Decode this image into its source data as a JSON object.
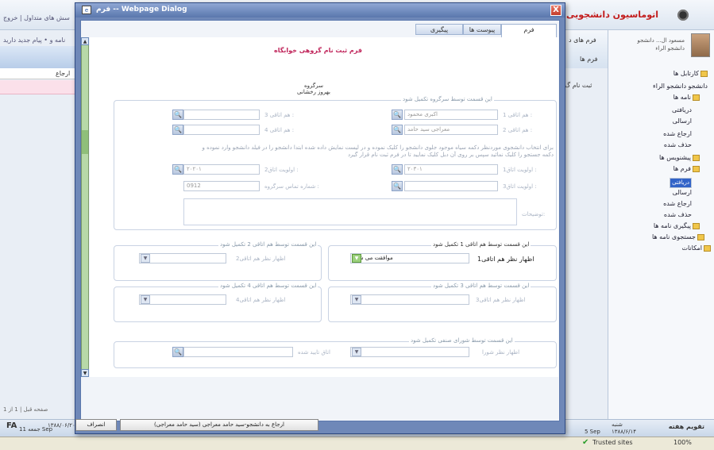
{
  "background": {
    "logo_text": "اتوماسیون دانشجویی",
    "top_links": "سش های متداول | خروج",
    "sub_links": "نامه و • پیام جدید دارید",
    "col_label": "ارجاع",
    "mid_header_l1": "فرم های د",
    "mid_header_l2": "فرم ها",
    "mid_row": "ثبت نام گ",
    "user_name": "مسعود ال... دانشجو دانشجو الراء",
    "tree": [
      {
        "label": "کارتابل ها",
        "selected": false
      },
      {
        "label": "دانشجو دانشجو الراء",
        "selected": false
      },
      {
        "label": "نامه ها",
        "selected": false
      },
      {
        "label": "دریافتی",
        "selected": false
      },
      {
        "label": "ارسالی",
        "selected": false
      },
      {
        "label": "ارجاع شده",
        "selected": false
      },
      {
        "label": "حذف شده",
        "selected": false
      },
      {
        "label": "پیشنویس ها",
        "selected": false
      },
      {
        "label": "فرم ها",
        "selected": false
      },
      {
        "label": "دریافتی",
        "selected": true
      },
      {
        "label": "ارسالی",
        "selected": false
      },
      {
        "label": "ارجاع شده",
        "selected": false
      },
      {
        "label": "حذف شده",
        "selected": false
      },
      {
        "label": "پیگیری نامه ها",
        "selected": false
      },
      {
        "label": "جستجوی نامه ها",
        "selected": false
      },
      {
        "label": "امکانات",
        "selected": false
      }
    ],
    "pager": "صفحه قبل | 1 از 1",
    "fa": "FA",
    "date_left": "جمعه",
    "date_left_num": "11 Sep",
    "date_left2": "۱۳۸۸/۰۶/۲۰",
    "date_right_day": "شنبه",
    "date_right_num": "۱۳۸۸/۶/۱۴",
    "date_5sep": "5 Sep",
    "today": "تقویم هفته",
    "trusted": "Trusted sites",
    "zoom": "100%"
  },
  "dialog": {
    "title": "فرم -- Webpage Dialog",
    "close": "X",
    "tabs": [
      "فرم",
      "پیوست ها",
      "پیگیری"
    ],
    "form_title": "فرم ثبت نام گروهی خوابگاه",
    "leader_label": "سرگروه",
    "leader_name": "بهروز رخشانی",
    "section1_legend": "این قسمت توسط سرگروه تکمیل شود",
    "roommate1_label": "هم اتاقی 1 :",
    "roommate1_value": "اکبری محمود",
    "roommate2_label": "هم اتاقی 2 :",
    "roommate2_value": "معراجی سید حامد",
    "roommate3_label": "هم اتاقی 3 :",
    "roommate4_label": "هم اتاقی 4 :",
    "note_text": "برای انتخاب دانشجوی موردنظر دکمه سیاه موجود جلوی دانشجو را کلیک نموده و در لیست نمایش داده شده ابتدا دانشجو را در فیلد دانشجو وارد نموده و دکمه جستجو را کلیک نمائید سپس بر روی آن دبل کلیک نمایید تا در فرم ثبت نام قرار گیرد",
    "note_bold1": "دکمه سیاه",
    "note_bold2": "دبل کلیک",
    "priority1_label": "اولویت اتاق1 :",
    "priority1_value": "۲۰۳۰۱",
    "priority2_label": "اولویت اتاق2 :",
    "priority2_value": "۲۰۲۰۱",
    "priority3_label": "اولویت اتاق3 :",
    "phone_label": "شماره تماس سرگروه :",
    "phone_value": "0912",
    "desc_label": "توضیحات:",
    "sec_rm1_legend": "این قسمت توسط هم اتاقی 1 تکمیل شود",
    "sec_rm1_label": "اظهار نظر هم اتاقی1",
    "sec_rm1_value": "موافقت می شود",
    "sec_rm2_legend": "این قسمت توسط هم اتاقی 2 تکمیل شود",
    "sec_rm2_label": "اظهار نظر هم اتاقی2",
    "sec_rm3_legend": "این قسمت توسط هم اتاقی 3 تکمیل شود",
    "sec_rm3_label": "اظهار نظر هم اتاقی3",
    "sec_rm4_legend": "این قسمت توسط هم اتاقی 4 تکمیل شود",
    "sec_rm4_label": "اظهار نظر هم اتاقی4",
    "council_legend": "این قسمت توسط شورای صنفی تکمیل شود",
    "council_label": "اظهار نظر شورا",
    "room_confirmed_label": "اتاق تایید شده",
    "btn_back": "ارجاع به دانشجو-سید حامد معراجی (سید حامد معراجی)",
    "btn_cancel": "انصراف"
  }
}
